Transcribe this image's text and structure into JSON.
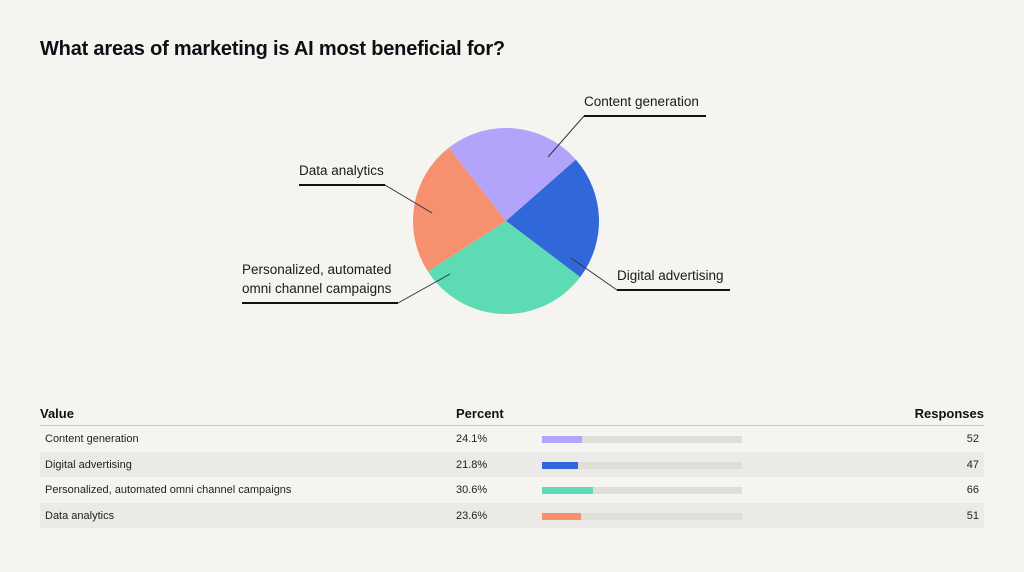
{
  "title": "What areas of marketing is AI most beneficial for?",
  "table": {
    "headers": {
      "value": "Value",
      "percent": "Percent",
      "responses": "Responses"
    },
    "rows": [
      {
        "label": "Content generation",
        "percent_text": "24.1%",
        "percent": 24.1,
        "responses": "52",
        "color": "#b2a4fb"
      },
      {
        "label": "Digital advertising",
        "percent_text": "21.8%",
        "percent": 21.8,
        "responses": "47",
        "color": "#3068d9"
      },
      {
        "label": "Personalized, automated omni channel campaigns",
        "percent_text": "30.6%",
        "percent": 30.6,
        "responses": "66",
        "color": "#5cdbb4"
      },
      {
        "label": "Data analytics",
        "percent_text": "23.6%",
        "percent": 23.6,
        "responses": "51",
        "color": "#f6906e"
      }
    ]
  },
  "chart_data": {
    "type": "pie",
    "title": "What areas of marketing is AI most beneficial for?",
    "categories": [
      "Content generation",
      "Digital advertising",
      "Personalized, automated omni channel campaigns",
      "Data analytics"
    ],
    "values": [
      24.1,
      21.8,
      30.6,
      23.6
    ],
    "responses": [
      52,
      47,
      66,
      51
    ],
    "colors": [
      "#b2a4fb",
      "#3068d9",
      "#5cdbb4",
      "#f6906e"
    ],
    "labels": {
      "content": "Content generation",
      "digital": "Digital advertising",
      "personalized_line1": "Personalized, automated",
      "personalized_line2": "omni channel campaigns",
      "data": "Data analytics"
    }
  }
}
